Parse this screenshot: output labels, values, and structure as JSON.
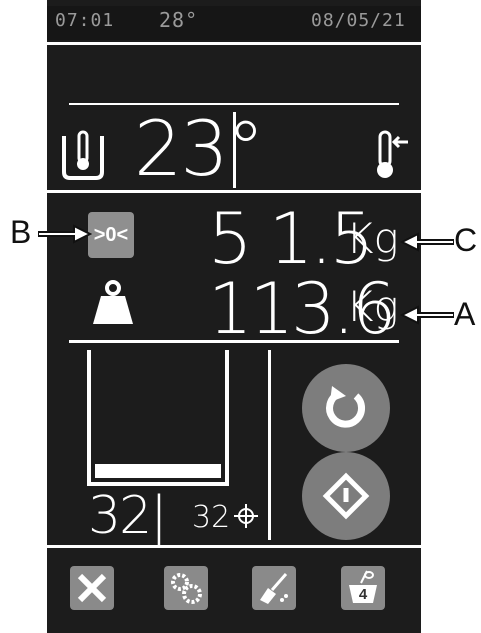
{
  "status": {
    "time": "07:01",
    "temperature": "28°",
    "date": "08/05/21"
  },
  "temperature_panel": {
    "value": "23°"
  },
  "weight_panel": {
    "tare_label": ">0<",
    "net_value": "5 1.5",
    "net_unit": "Kg",
    "gross_value": "113.6",
    "gross_unit": "Kg"
  },
  "tank": {
    "level_fraction": 0.12,
    "count": "32|",
    "sub_value": "32"
  },
  "callouts": {
    "a": "A",
    "b": "B",
    "c": "C"
  },
  "icons": {
    "thermo_left": "thermometer-in-container-icon",
    "thermo_right": "thermometer-arrow-icon",
    "weight": "weight-icon",
    "reset": "reset-icon",
    "start": "start-diamond-icon",
    "tools": "tools-icon",
    "settings": "gears-icon",
    "cleaning": "broom-icon",
    "recipe": "mixing-bowl-icon"
  },
  "toolbar": {
    "recipe_number": "4"
  },
  "colors": {
    "background": "#1c1c1c",
    "button": "#7d7d7d",
    "text": "#ffffff"
  }
}
